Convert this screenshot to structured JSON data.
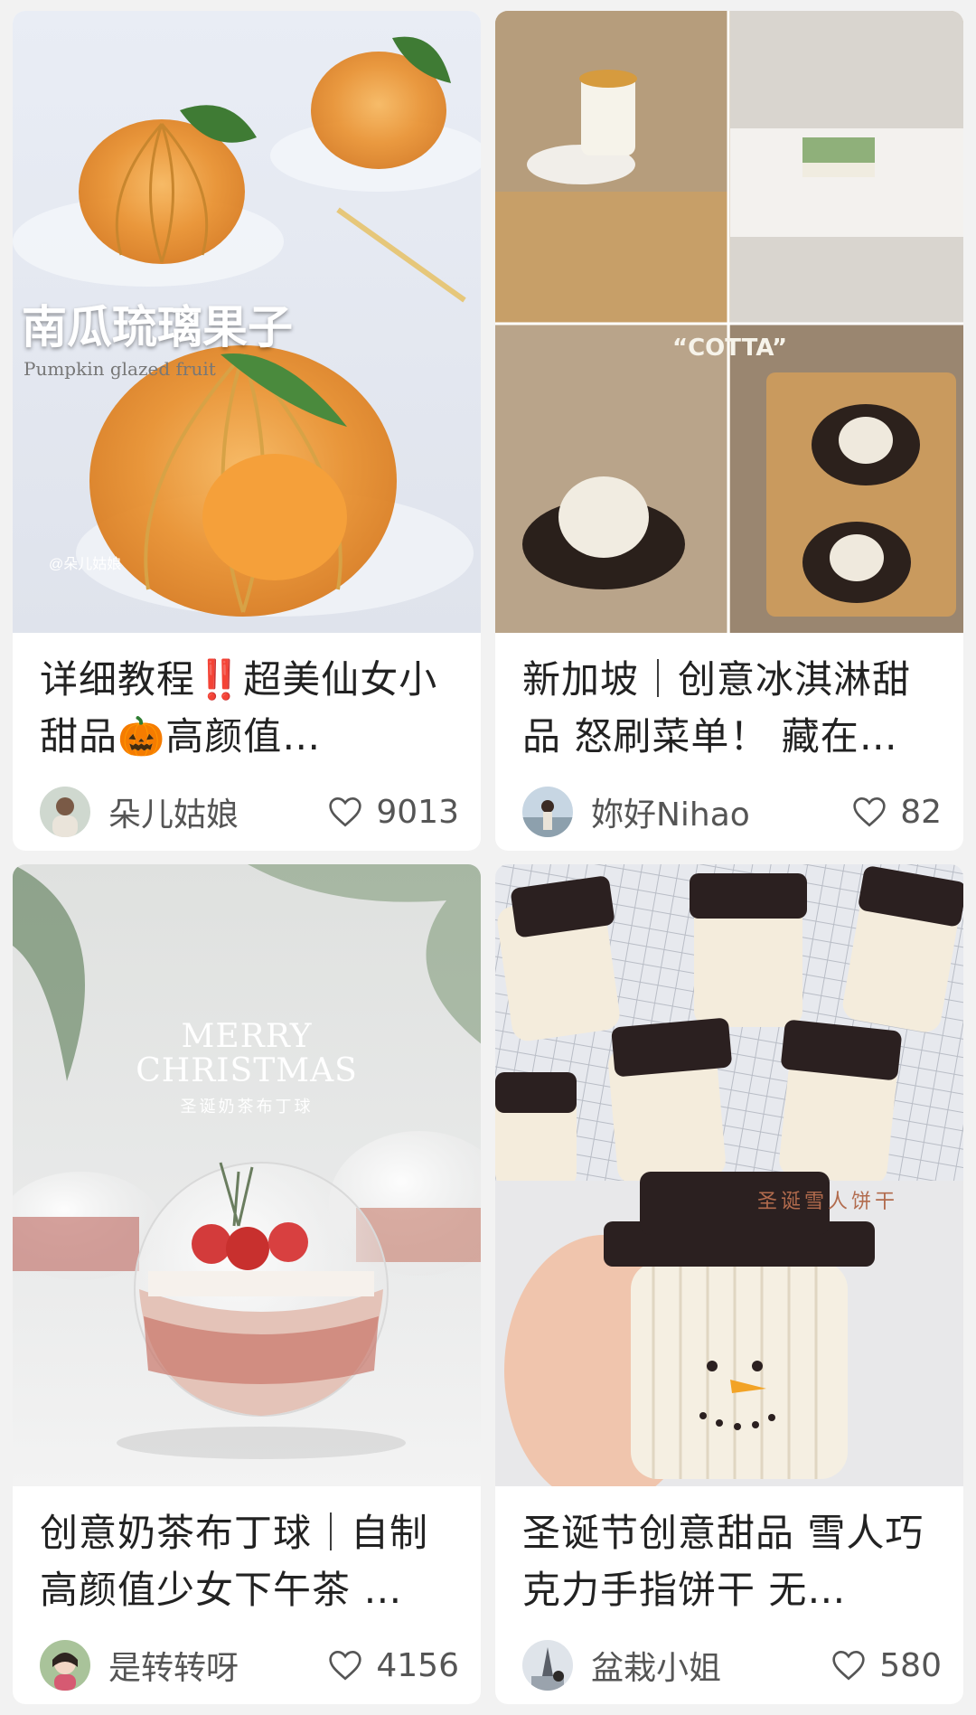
{
  "cards": [
    {
      "title": "详细教程‼️超美仙女小甜品🎃高颜值…",
      "author": "朵儿姑娘",
      "likes": "9013",
      "cover_text": {
        "title": "南瓜琉璃果子",
        "subtitle": "Pumpkin glazed fruit",
        "watermark": "@朵儿姑娘"
      },
      "icons": [
        "heart-icon",
        "avatar"
      ]
    },
    {
      "title": "新加坡｜创意冰淇淋甜品 怒刷菜单！ 藏在…",
      "author": "妳好Nihao",
      "likes": "82",
      "cover_text": {
        "label": "“COTTA”"
      }
    },
    {
      "title": "创意奶茶布丁球｜自制高颜值少女下午茶 …",
      "author": "是转转呀",
      "likes": "4156",
      "cover_text": {
        "line1": "MERRY",
        "line2": "CHRISTMAS",
        "subtitle": "圣诞奶茶布丁球"
      }
    },
    {
      "title": "圣诞节创意甜品 雪人巧克力手指饼干 无…",
      "author": "盆栽小姐",
      "likes": "580",
      "cover_text": {
        "label": "圣诞雪人饼干"
      }
    }
  ],
  "colors": {
    "background": "#f2f2f2",
    "card": "#ffffff",
    "text": "#222222",
    "meta": "#555555"
  }
}
